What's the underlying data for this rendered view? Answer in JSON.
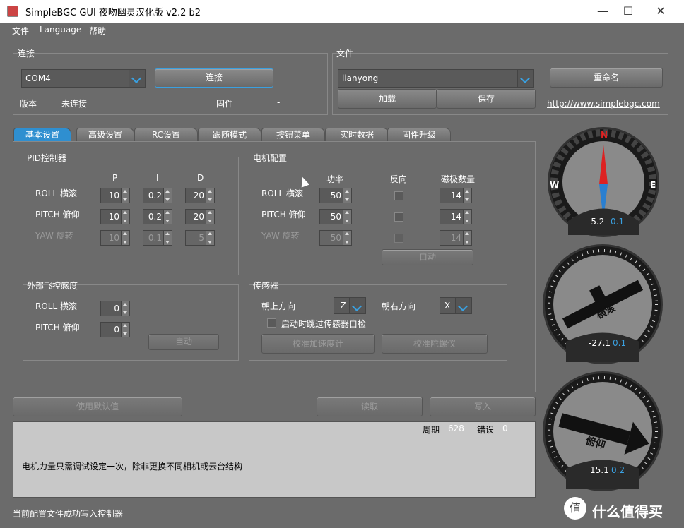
{
  "window": {
    "title": "SimpleBGC GUI 夜吻幽灵汉化版 v2.2 b2",
    "minimize": "—",
    "maximize": "☐",
    "close": "✕"
  },
  "menu": [
    "文件",
    "Language",
    "帮助"
  ],
  "connection": {
    "title": "连接",
    "port": "COM4",
    "connect_label": "连接",
    "version_label": "版本",
    "version_value": "未连接",
    "firmware_label": "固件",
    "firmware_value": "-"
  },
  "file": {
    "title": "文件",
    "profile": "lianyong",
    "rename_label": "重命名",
    "load_label": "加载",
    "save_label": "保存",
    "link": "http://www.simplebgc.com"
  },
  "tabs": [
    "基本设置",
    "高级设置",
    "RC设置",
    "跟随模式",
    "按钮菜单",
    "实时数据",
    "固件升级"
  ],
  "pid": {
    "title": "PID控制器",
    "headers": [
      "P",
      "I",
      "D"
    ],
    "rows": [
      {
        "label": "ROLL 横滚",
        "p": "10",
        "i": "0.2",
        "d": "20"
      },
      {
        "label": "PITCH 俯仰",
        "p": "10",
        "i": "0.2",
        "d": "20"
      },
      {
        "label": "YAW 旋转",
        "p": "10",
        "i": "0.1",
        "d": "5"
      }
    ]
  },
  "motor": {
    "title": "电机配置",
    "headers": [
      "功率",
      "反向",
      "磁极数量"
    ],
    "rows": [
      {
        "label": "ROLL 横滚",
        "power": "50",
        "poles": "14"
      },
      {
        "label": "PITCH 俯仰",
        "power": "50",
        "poles": "14"
      },
      {
        "label": "YAW 旋转",
        "power": "50",
        "poles": "14"
      }
    ],
    "auto_label": "自动"
  },
  "ext": {
    "title": "外部飞控感度",
    "rows": [
      {
        "label": "ROLL 横滚",
        "value": "0"
      },
      {
        "label": "PITCH 俯仰",
        "value": "0"
      }
    ],
    "auto_label": "自动"
  },
  "sensor": {
    "title": "传感器",
    "top_label": "朝上方向",
    "top_value": "-Z",
    "right_label": "朝右方向",
    "right_value": "X",
    "skip_label": "启动时跳过传感器自检",
    "calib_acc": "校准加速度计",
    "calib_gyro": "校准陀螺仪"
  },
  "actions": {
    "defaults": "使用默认值",
    "read": "读取",
    "write": "写入"
  },
  "log": {
    "cycle_label": "周期",
    "cycle_value": "628",
    "error_label": "错误",
    "error_value": "0",
    "message": "电机力量只需调试设定一次，除非更换不同相机或云台结构"
  },
  "status": "当前配置文件成功写入控制器",
  "gauges": {
    "compass": {
      "n": "N",
      "w": "W",
      "e": "E",
      "value": "-5.2",
      "sub": "0.1"
    },
    "roll": {
      "label": "横滚",
      "value": "-27.1",
      "sub": "0.1"
    },
    "pitch": {
      "label": "俯仰",
      "value": "15.1",
      "sub": "0.2"
    }
  },
  "watermark": "什么值得买",
  "colors": {
    "accent": "#2f8fd0",
    "panel": "#6b6b6b"
  }
}
